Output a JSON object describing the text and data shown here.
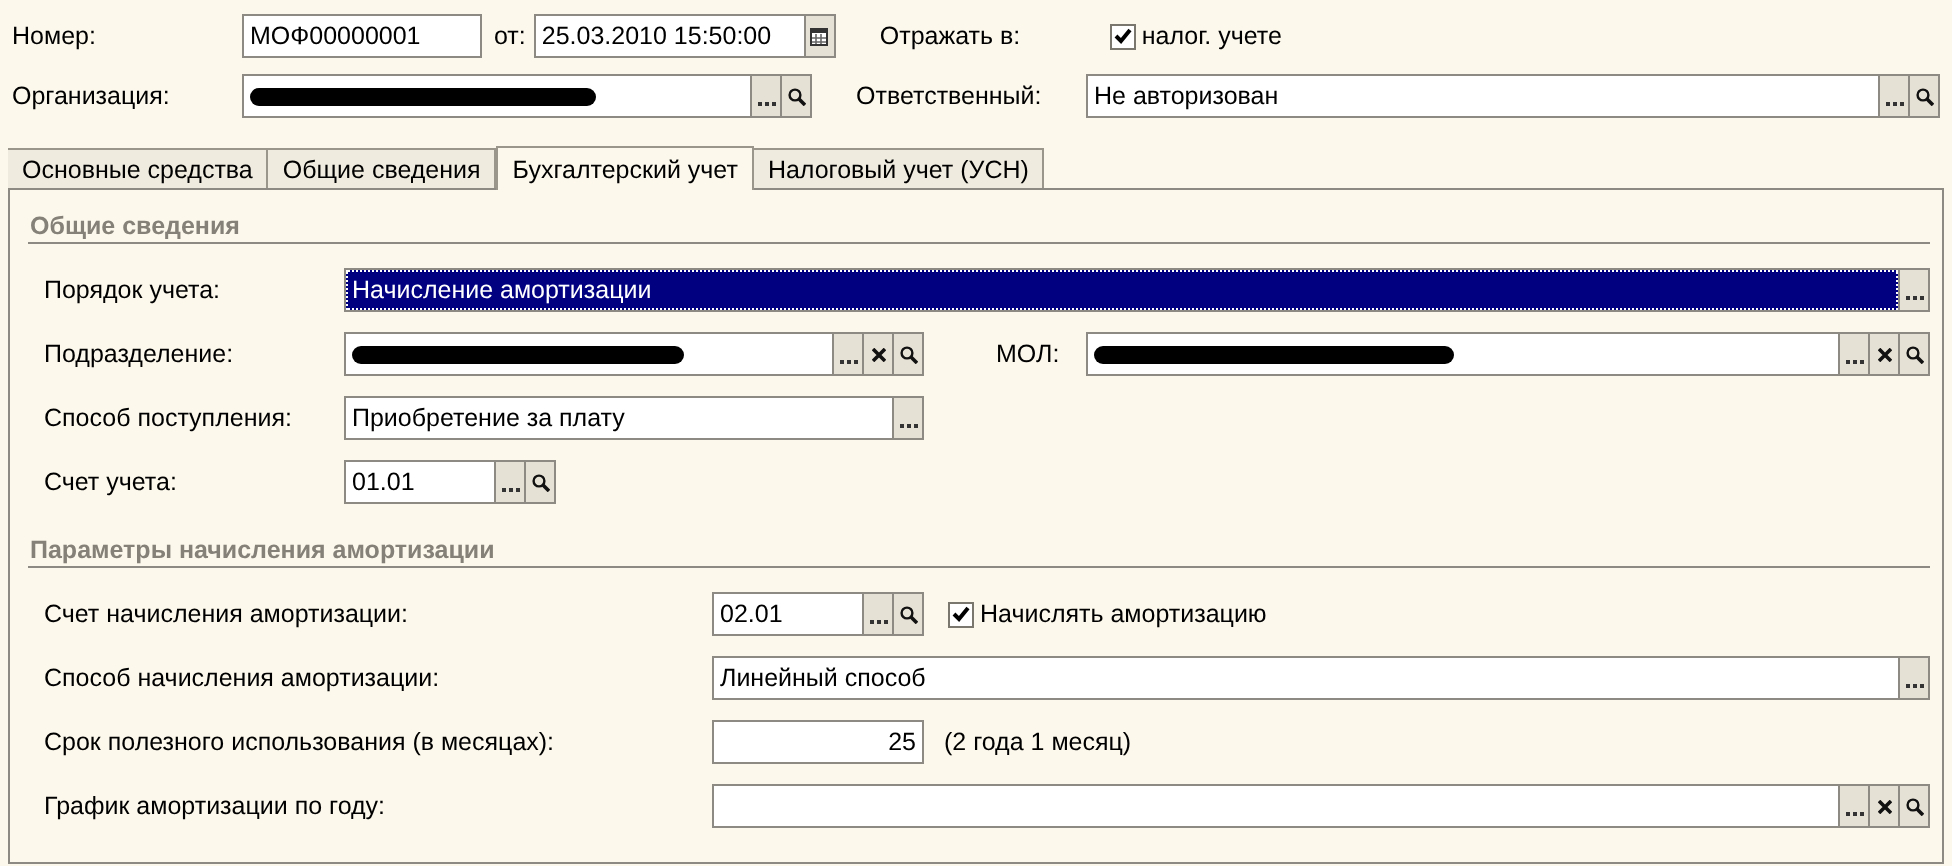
{
  "header": {
    "number": {
      "label": "Номер:",
      "value": "МОФ00000001",
      "kind": "code"
    },
    "date": {
      "label": "от:",
      "value": "25.03.2010 15:50:00",
      "kind": "date",
      "buttons": [
        {
          "kind": "calendar"
        }
      ]
    },
    "reflect": {
      "label": "Отражать в:",
      "checkbox": {
        "label": "налог. учете",
        "checked": true
      }
    },
    "organization": {
      "label": "Организация:",
      "kind": "org",
      "redacted": true,
      "buttons": [
        {
          "kind": "choose"
        },
        {
          "kind": "search"
        }
      ]
    },
    "responsible": {
      "label": "Ответственный:",
      "value": "Не авторизован",
      "kind": "wide",
      "buttons": [
        {
          "kind": "choose"
        },
        {
          "kind": "search"
        }
      ]
    }
  },
  "tabs": [
    {
      "label": "Основные средства",
      "selected": false
    },
    {
      "label": "Общие сведения",
      "selected": false
    },
    {
      "label": "Бухгалтерский учет",
      "selected": true
    },
    {
      "label": "Налоговый учет (УСН)",
      "selected": false
    }
  ],
  "sections": [
    {
      "title": "Общие сведения",
      "rows": [
        {
          "label": "Порядок учета:",
          "field": {
            "value": "Начисление амортизации",
            "kind": "wide",
            "selected": true,
            "buttons": [
              {
                "kind": "choose"
              }
            ]
          }
        },
        {
          "label": "Подразделение:",
          "field": {
            "redacted": true,
            "kind": "medium",
            "buttons": [
              {
                "kind": "choose"
              },
              {
                "kind": "clear"
              },
              {
                "kind": "search"
              }
            ]
          },
          "side": {
            "label": "МОЛ:",
            "field": {
              "redacted": true,
              "kind": "wide",
              "buttons": [
                {
                  "kind": "choose"
                },
                {
                  "kind": "clear"
                },
                {
                  "kind": "search"
                }
              ]
            }
          }
        },
        {
          "label": "Способ поступления:",
          "field": {
            "value": "Приобретение за плату",
            "kind": "medium",
            "buttons": [
              {
                "kind": "choose"
              }
            ]
          }
        },
        {
          "label": "Счет учета:",
          "field": {
            "value": "01.01",
            "kind": "short",
            "buttons": [
              {
                "kind": "choose"
              },
              {
                "kind": "search"
              }
            ]
          }
        }
      ]
    },
    {
      "title": "Параметры начисления амортизации",
      "rows": [
        {
          "label": "Счет начисления амортизации:",
          "field": {
            "value": "02.01",
            "kind": "short",
            "buttons": [
              {
                "kind": "choose"
              },
              {
                "kind": "search"
              }
            ]
          },
          "checkbox": {
            "label": "Начислять амортизацию",
            "checked": true
          }
        },
        {
          "label": "Способ начисления амортизации:",
          "field": {
            "value": "Линейный способ",
            "kind": "wide",
            "buttons": [
              {
                "kind": "choose"
              }
            ]
          }
        },
        {
          "label": "Срок полезного использования (в месяцах):",
          "field": {
            "value": "25",
            "kind": "number"
          },
          "note": "(2 года 1 месяц)"
        },
        {
          "label": "График амортизации по году:",
          "field": {
            "kind": "wide",
            "buttons": [
              {
                "kind": "choose"
              },
              {
                "kind": "clear"
              },
              {
                "kind": "search"
              }
            ]
          }
        }
      ]
    }
  ]
}
